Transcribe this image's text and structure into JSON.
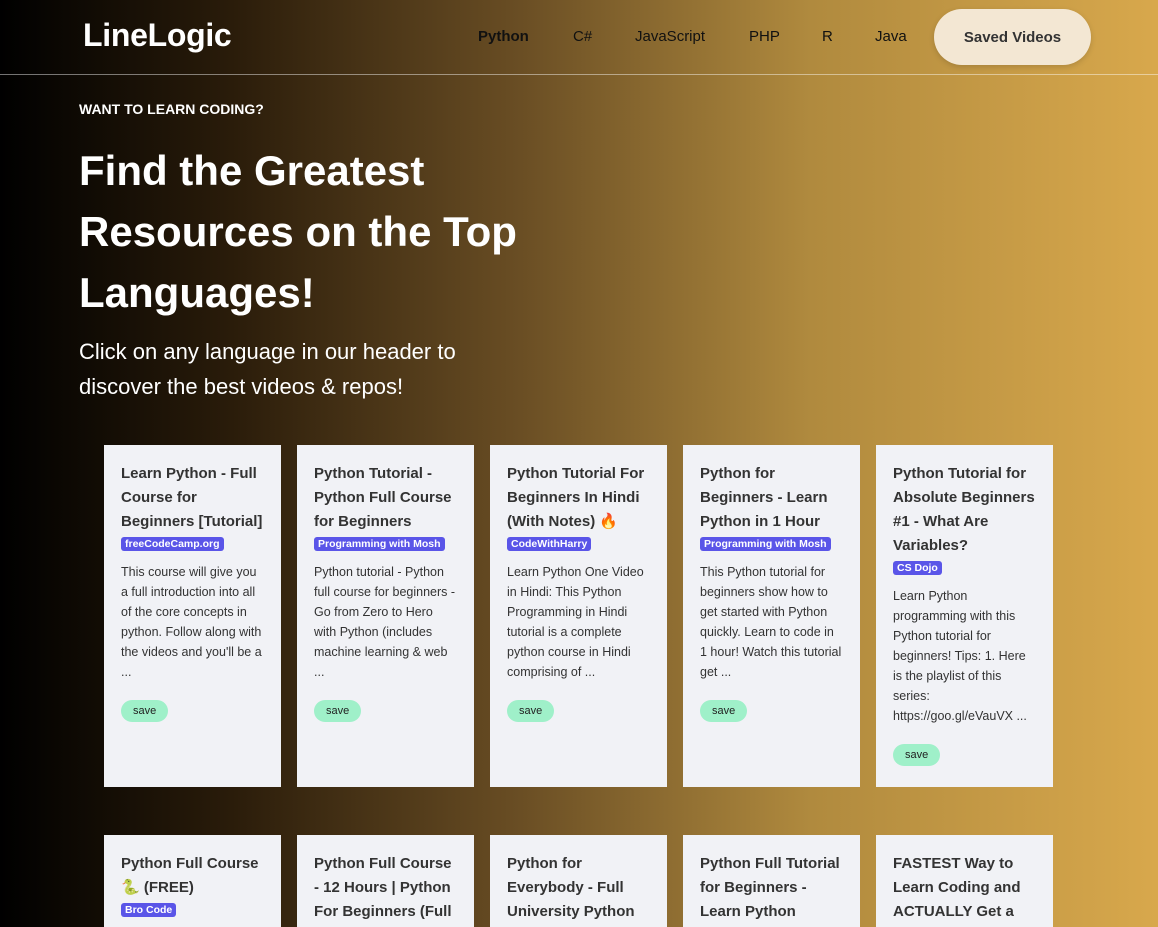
{
  "header": {
    "brand": "LineLogic",
    "nav": [
      "Python",
      "C#",
      "JavaScript",
      "PHP",
      "R",
      "Java"
    ],
    "saved_label": "Saved Videos"
  },
  "hero": {
    "eyebrow": "WANT TO LEARN CODING?",
    "title": "Find the Greatest Resources on the Top Languages!",
    "subtitle": "Click on any language in our header to discover the best videos & repos!"
  },
  "save_label": "save",
  "videos": [
    {
      "title": "Learn Python - Full Course for Beginners [Tutorial]",
      "channel": "freeCodeCamp.org",
      "desc": "This course will give you a full introduction into all of the core concepts in python. Follow along with the videos and you'll be a ..."
    },
    {
      "title": "Python Tutorial - Python Full Course for Beginners",
      "channel": "Programming with Mosh",
      "desc": "Python tutorial - Python full course for beginners - Go from Zero to Hero with Python (includes machine learning & web ..."
    },
    {
      "title": "Python Tutorial For Beginners In Hindi (With Notes) 🔥",
      "channel": "CodeWithHarry",
      "desc": "Learn Python One Video in Hindi: This Python Programming in Hindi tutorial is a complete python course in Hindi comprising of ..."
    },
    {
      "title": "Python for Beginners - Learn Python in 1 Hour",
      "channel": "Programming with Mosh",
      "desc": "This Python tutorial for beginners show how to get started with Python quickly. Learn to code in 1 hour! Watch this tutorial get ..."
    },
    {
      "title": "Python Tutorial for Absolute Beginners #1 - What Are Variables?",
      "channel": "CS Dojo",
      "desc": "Learn Python programming with this Python tutorial for beginners! Tips: 1. Here is the playlist of this series: https://goo.gl/eVauVX ..."
    },
    {
      "title": "Python Full Course 🐍 (FREE)",
      "channel": "Bro Code",
      "desc": ""
    },
    {
      "title": "Python Full Course - 12 Hours | Python For Beginners (Full",
      "channel": "",
      "desc": ""
    },
    {
      "title": "Python for Everybody - Full University Python",
      "channel": "",
      "desc": ""
    },
    {
      "title": "Python Full Tutorial for Beginners - Learn Python",
      "channel": "",
      "desc": ""
    },
    {
      "title": "FASTEST Way to Learn Coding and ACTUALLY Get a Job",
      "channel": "",
      "desc": ""
    }
  ]
}
